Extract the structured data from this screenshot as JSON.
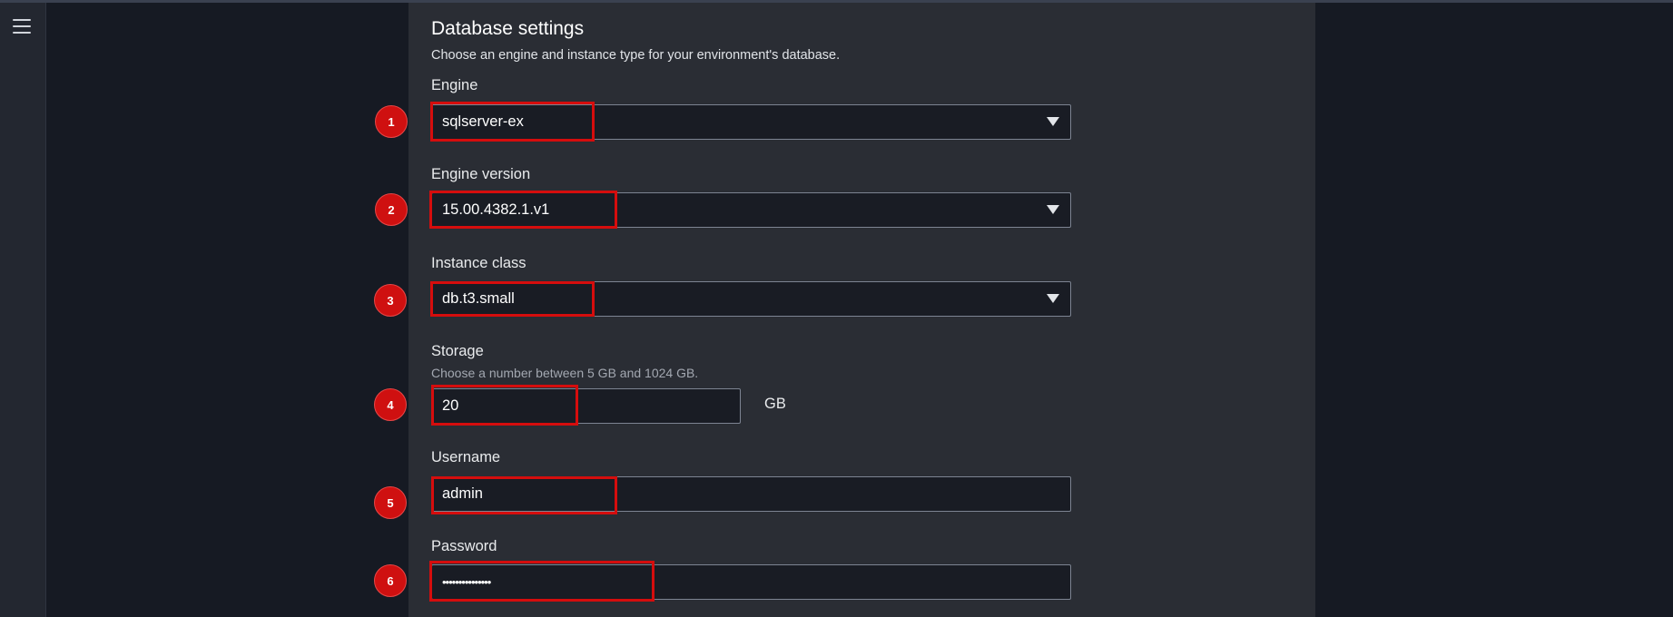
{
  "sidebar": {
    "menu_icon": "hamburger-menu-icon"
  },
  "section": {
    "title": "Database settings",
    "description": "Choose an engine and instance type for your environment's database."
  },
  "fields": {
    "engine": {
      "label": "Engine",
      "value": "sqlserver-ex",
      "icon": "caret-down-icon"
    },
    "engine_version": {
      "label": "Engine version",
      "value": "15.00.4382.1.v1",
      "icon": "caret-down-icon"
    },
    "instance_class": {
      "label": "Instance class",
      "value": "db.t3.small",
      "icon": "caret-down-icon"
    },
    "storage": {
      "label": "Storage",
      "hint": "Choose a number between 5 GB and 1024 GB.",
      "value": "20",
      "unit": "GB"
    },
    "username": {
      "label": "Username",
      "value": "admin"
    },
    "password": {
      "label": "Password",
      "value": "•••••••••••••••"
    }
  },
  "annotations": {
    "color": "#d50d0d",
    "badges": [
      "1",
      "2",
      "3",
      "4",
      "5",
      "6"
    ]
  }
}
